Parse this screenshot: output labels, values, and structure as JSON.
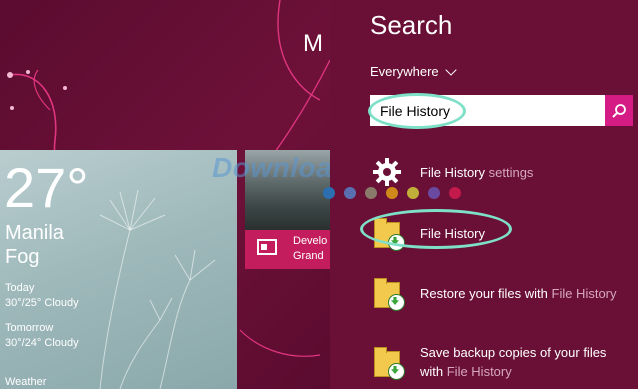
{
  "start_screen": {
    "title": "M",
    "weather": {
      "temperature": "27°",
      "city": "Manila",
      "condition": "Fog",
      "forecast": [
        {
          "day": "Today",
          "value": "30°/25° Cloudy"
        },
        {
          "day": "Tomorrow",
          "value": "30°/24° Cloudy"
        }
      ],
      "footer": "Weather"
    },
    "news": {
      "line1": "Develo",
      "line2": "Grand"
    }
  },
  "watermark": "Download",
  "search": {
    "title": "Search",
    "scope": "Everywhere",
    "query": "File History",
    "results": [
      {
        "icon": "settings-gear-icon",
        "text_prefix": "",
        "text_match": "File History",
        "text_suffix": " settings"
      },
      {
        "icon": "file-history-icon",
        "text_prefix": "",
        "text_match": "File History",
        "text_suffix": ""
      },
      {
        "icon": "file-history-icon",
        "text_prefix": "Restore your files with ",
        "text_match": "File History",
        "text_suffix": ""
      },
      {
        "icon": "file-history-icon",
        "text_prefix": "Save backup copies of your files",
        "line2_prefix": "with ",
        "text_match": "File History",
        "text_suffix": ""
      }
    ]
  },
  "colors": {
    "background": "#6a0f36",
    "accent": "#d41c84",
    "highlight": "#7fe0c8",
    "news_bar": "#c41d5e"
  }
}
